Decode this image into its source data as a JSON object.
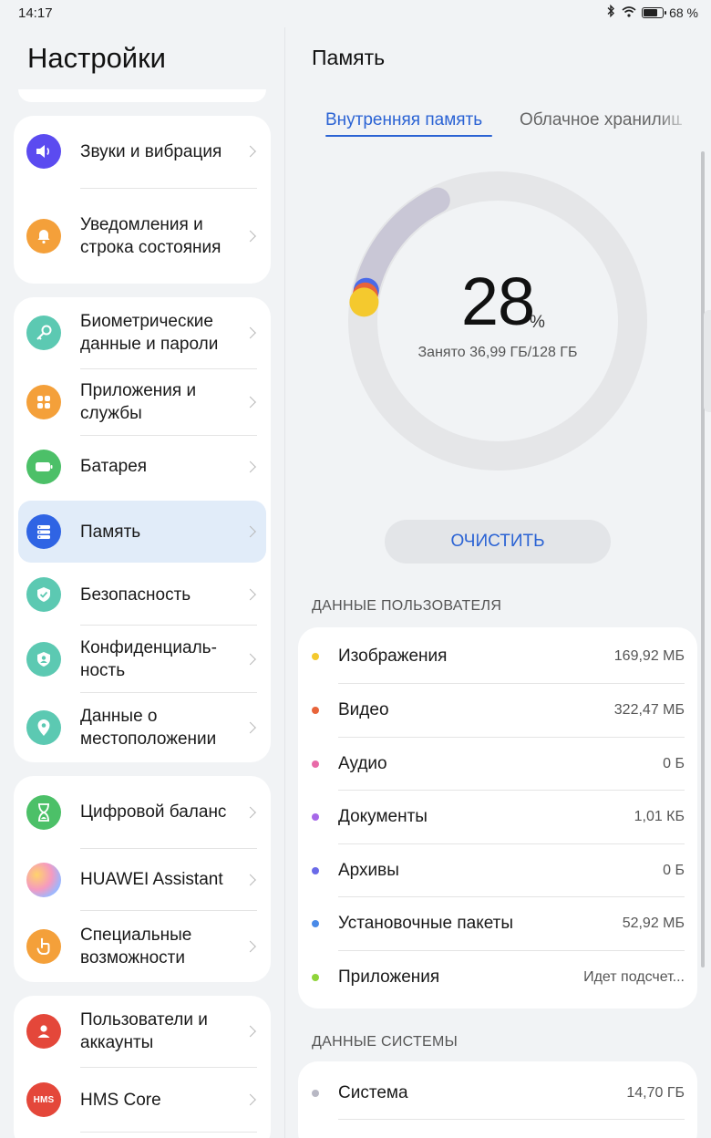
{
  "status_bar": {
    "time": "14:17",
    "battery": "68 %"
  },
  "sidebar": {
    "title": "Настройки",
    "groups": [
      {
        "items": [
          {
            "label": "Звуки и вибрация",
            "icon": "sound-icon",
            "color": "#5b4bf0"
          },
          {
            "label": "Уведомления и строка состояния",
            "icon": "bell-icon",
            "color": "#f4a03a"
          }
        ]
      },
      {
        "items": [
          {
            "label": "Биометрические данные и пароли",
            "icon": "key-icon",
            "color": "#5cc9b2"
          },
          {
            "label": "Приложения и службы",
            "icon": "apps-icon",
            "color": "#f4a03a"
          },
          {
            "label": "Батарея",
            "icon": "battery-icon",
            "color": "#4cc068"
          },
          {
            "label": "Память",
            "icon": "storage-icon",
            "color": "#2f64e4",
            "selected": true
          },
          {
            "label": "Безопасность",
            "icon": "shield-check-icon",
            "color": "#5cc9b2"
          },
          {
            "label": "Конфиденциаль-ность",
            "icon": "privacy-shield-icon",
            "color": "#5cc9b2"
          },
          {
            "label": "Данные о местоположении",
            "icon": "location-pin-icon",
            "color": "#5cc9b2"
          }
        ]
      },
      {
        "items": [
          {
            "label": "Цифровой баланс",
            "icon": "hourglass-icon",
            "color": "#4cc068"
          },
          {
            "label": "HUAWEI Assistant",
            "icon": "assistant-icon",
            "color": "#c89bf0"
          },
          {
            "label": "Специальные возможности",
            "icon": "hand-icon",
            "color": "#f4a03a"
          }
        ]
      },
      {
        "items": [
          {
            "label": "Пользователи и аккаунты",
            "icon": "user-icon",
            "color": "#e4473a"
          },
          {
            "label": "HMS Core",
            "icon": "hms-icon",
            "color": "#e4473a",
            "icon_text": "HMS"
          }
        ]
      }
    ]
  },
  "main": {
    "title": "Память",
    "tabs": [
      {
        "label": "Внутренняя память",
        "active": true
      },
      {
        "label": "Облачное хранилище",
        "active": false
      }
    ],
    "usage": {
      "percent": "28",
      "percent_sign": "%",
      "used_text": "Занято 36,99 ГБ/128 ГБ",
      "fraction": 0.28
    },
    "clean_button": "ОЧИСТИТЬ",
    "user_data": {
      "header": "ДАННЫЕ ПОЛЬЗОВАТЕЛЯ",
      "rows": [
        {
          "label": "Изображения",
          "value": "169,92 МБ",
          "color": "#f4c92e"
        },
        {
          "label": "Видео",
          "value": "322,47 МБ",
          "color": "#e8643a"
        },
        {
          "label": "Аудио",
          "value": "0 Б",
          "color": "#e86aa8"
        },
        {
          "label": "Документы",
          "value": "1,01 КБ",
          "color": "#a668e8"
        },
        {
          "label": "Архивы",
          "value": "0 Б",
          "color": "#6a6ae8"
        },
        {
          "label": "Установочные пакеты",
          "value": "52,92 МБ",
          "color": "#4a8ae8"
        },
        {
          "label": "Приложения",
          "value": "Идет подсчет...",
          "color": "#8fd43a"
        }
      ]
    },
    "system_data": {
      "header": "ДАННЫЕ СИСТЕМЫ",
      "rows": [
        {
          "label": "Система",
          "value": "14,70 ГБ",
          "color": "#b8b8c4"
        }
      ]
    }
  }
}
